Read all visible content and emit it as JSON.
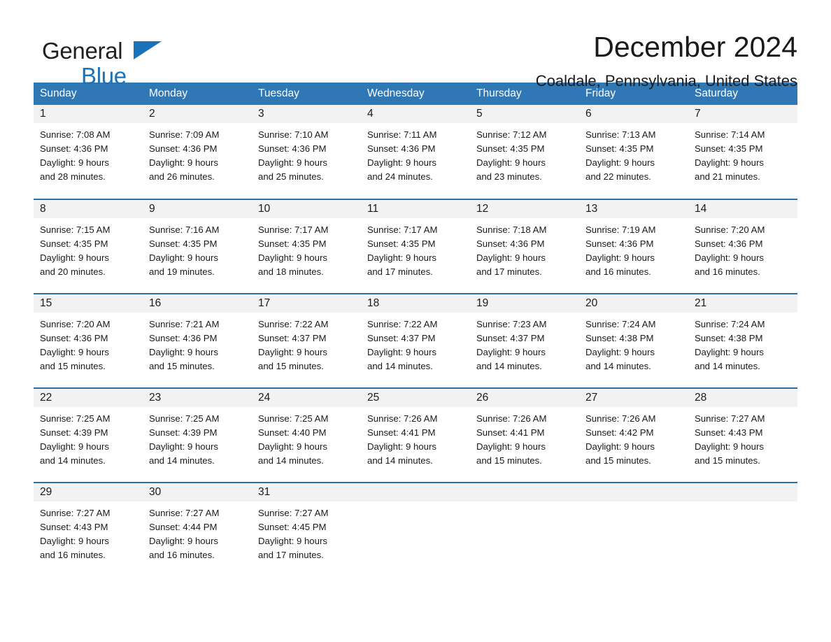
{
  "logo": {
    "word_general": "General",
    "word_blue": "Blue",
    "triangle_color": "#1b72b8"
  },
  "header": {
    "month_title": "December 2024",
    "location": "Coaldale, Pennsylvania, United States"
  },
  "theme": {
    "header_blue": "#3077b5",
    "row_divider_blue": "#2e6da4",
    "daynum_band": "#f2f2f2",
    "text": "#1a1a1a"
  },
  "calendar": {
    "weekday_headers": [
      "Sunday",
      "Monday",
      "Tuesday",
      "Wednesday",
      "Thursday",
      "Friday",
      "Saturday"
    ],
    "weeks": [
      [
        {
          "day": "1",
          "sunrise": "Sunrise: 7:08 AM",
          "sunset": "Sunset: 4:36 PM",
          "daylight_1": "Daylight: 9 hours",
          "daylight_2": "and 28 minutes."
        },
        {
          "day": "2",
          "sunrise": "Sunrise: 7:09 AM",
          "sunset": "Sunset: 4:36 PM",
          "daylight_1": "Daylight: 9 hours",
          "daylight_2": "and 26 minutes."
        },
        {
          "day": "3",
          "sunrise": "Sunrise: 7:10 AM",
          "sunset": "Sunset: 4:36 PM",
          "daylight_1": "Daylight: 9 hours",
          "daylight_2": "and 25 minutes."
        },
        {
          "day": "4",
          "sunrise": "Sunrise: 7:11 AM",
          "sunset": "Sunset: 4:36 PM",
          "daylight_1": "Daylight: 9 hours",
          "daylight_2": "and 24 minutes."
        },
        {
          "day": "5",
          "sunrise": "Sunrise: 7:12 AM",
          "sunset": "Sunset: 4:35 PM",
          "daylight_1": "Daylight: 9 hours",
          "daylight_2": "and 23 minutes."
        },
        {
          "day": "6",
          "sunrise": "Sunrise: 7:13 AM",
          "sunset": "Sunset: 4:35 PM",
          "daylight_1": "Daylight: 9 hours",
          "daylight_2": "and 22 minutes."
        },
        {
          "day": "7",
          "sunrise": "Sunrise: 7:14 AM",
          "sunset": "Sunset: 4:35 PM",
          "daylight_1": "Daylight: 9 hours",
          "daylight_2": "and 21 minutes."
        }
      ],
      [
        {
          "day": "8",
          "sunrise": "Sunrise: 7:15 AM",
          "sunset": "Sunset: 4:35 PM",
          "daylight_1": "Daylight: 9 hours",
          "daylight_2": "and 20 minutes."
        },
        {
          "day": "9",
          "sunrise": "Sunrise: 7:16 AM",
          "sunset": "Sunset: 4:35 PM",
          "daylight_1": "Daylight: 9 hours",
          "daylight_2": "and 19 minutes."
        },
        {
          "day": "10",
          "sunrise": "Sunrise: 7:17 AM",
          "sunset": "Sunset: 4:35 PM",
          "daylight_1": "Daylight: 9 hours",
          "daylight_2": "and 18 minutes."
        },
        {
          "day": "11",
          "sunrise": "Sunrise: 7:17 AM",
          "sunset": "Sunset: 4:35 PM",
          "daylight_1": "Daylight: 9 hours",
          "daylight_2": "and 17 minutes."
        },
        {
          "day": "12",
          "sunrise": "Sunrise: 7:18 AM",
          "sunset": "Sunset: 4:36 PM",
          "daylight_1": "Daylight: 9 hours",
          "daylight_2": "and 17 minutes."
        },
        {
          "day": "13",
          "sunrise": "Sunrise: 7:19 AM",
          "sunset": "Sunset: 4:36 PM",
          "daylight_1": "Daylight: 9 hours",
          "daylight_2": "and 16 minutes."
        },
        {
          "day": "14",
          "sunrise": "Sunrise: 7:20 AM",
          "sunset": "Sunset: 4:36 PM",
          "daylight_1": "Daylight: 9 hours",
          "daylight_2": "and 16 minutes."
        }
      ],
      [
        {
          "day": "15",
          "sunrise": "Sunrise: 7:20 AM",
          "sunset": "Sunset: 4:36 PM",
          "daylight_1": "Daylight: 9 hours",
          "daylight_2": "and 15 minutes."
        },
        {
          "day": "16",
          "sunrise": "Sunrise: 7:21 AM",
          "sunset": "Sunset: 4:36 PM",
          "daylight_1": "Daylight: 9 hours",
          "daylight_2": "and 15 minutes."
        },
        {
          "day": "17",
          "sunrise": "Sunrise: 7:22 AM",
          "sunset": "Sunset: 4:37 PM",
          "daylight_1": "Daylight: 9 hours",
          "daylight_2": "and 15 minutes."
        },
        {
          "day": "18",
          "sunrise": "Sunrise: 7:22 AM",
          "sunset": "Sunset: 4:37 PM",
          "daylight_1": "Daylight: 9 hours",
          "daylight_2": "and 14 minutes."
        },
        {
          "day": "19",
          "sunrise": "Sunrise: 7:23 AM",
          "sunset": "Sunset: 4:37 PM",
          "daylight_1": "Daylight: 9 hours",
          "daylight_2": "and 14 minutes."
        },
        {
          "day": "20",
          "sunrise": "Sunrise: 7:24 AM",
          "sunset": "Sunset: 4:38 PM",
          "daylight_1": "Daylight: 9 hours",
          "daylight_2": "and 14 minutes."
        },
        {
          "day": "21",
          "sunrise": "Sunrise: 7:24 AM",
          "sunset": "Sunset: 4:38 PM",
          "daylight_1": "Daylight: 9 hours",
          "daylight_2": "and 14 minutes."
        }
      ],
      [
        {
          "day": "22",
          "sunrise": "Sunrise: 7:25 AM",
          "sunset": "Sunset: 4:39 PM",
          "daylight_1": "Daylight: 9 hours",
          "daylight_2": "and 14 minutes."
        },
        {
          "day": "23",
          "sunrise": "Sunrise: 7:25 AM",
          "sunset": "Sunset: 4:39 PM",
          "daylight_1": "Daylight: 9 hours",
          "daylight_2": "and 14 minutes."
        },
        {
          "day": "24",
          "sunrise": "Sunrise: 7:25 AM",
          "sunset": "Sunset: 4:40 PM",
          "daylight_1": "Daylight: 9 hours",
          "daylight_2": "and 14 minutes."
        },
        {
          "day": "25",
          "sunrise": "Sunrise: 7:26 AM",
          "sunset": "Sunset: 4:41 PM",
          "daylight_1": "Daylight: 9 hours",
          "daylight_2": "and 14 minutes."
        },
        {
          "day": "26",
          "sunrise": "Sunrise: 7:26 AM",
          "sunset": "Sunset: 4:41 PM",
          "daylight_1": "Daylight: 9 hours",
          "daylight_2": "and 15 minutes."
        },
        {
          "day": "27",
          "sunrise": "Sunrise: 7:26 AM",
          "sunset": "Sunset: 4:42 PM",
          "daylight_1": "Daylight: 9 hours",
          "daylight_2": "and 15 minutes."
        },
        {
          "day": "28",
          "sunrise": "Sunrise: 7:27 AM",
          "sunset": "Sunset: 4:43 PM",
          "daylight_1": "Daylight: 9 hours",
          "daylight_2": "and 15 minutes."
        }
      ],
      [
        {
          "day": "29",
          "sunrise": "Sunrise: 7:27 AM",
          "sunset": "Sunset: 4:43 PM",
          "daylight_1": "Daylight: 9 hours",
          "daylight_2": "and 16 minutes."
        },
        {
          "day": "30",
          "sunrise": "Sunrise: 7:27 AM",
          "sunset": "Sunset: 4:44 PM",
          "daylight_1": "Daylight: 9 hours",
          "daylight_2": "and 16 minutes."
        },
        {
          "day": "31",
          "sunrise": "Sunrise: 7:27 AM",
          "sunset": "Sunset: 4:45 PM",
          "daylight_1": "Daylight: 9 hours",
          "daylight_2": "and 17 minutes."
        },
        {
          "day": "",
          "sunrise": "",
          "sunset": "",
          "daylight_1": "",
          "daylight_2": ""
        },
        {
          "day": "",
          "sunrise": "",
          "sunset": "",
          "daylight_1": "",
          "daylight_2": ""
        },
        {
          "day": "",
          "sunrise": "",
          "sunset": "",
          "daylight_1": "",
          "daylight_2": ""
        },
        {
          "day": "",
          "sunrise": "",
          "sunset": "",
          "daylight_1": "",
          "daylight_2": ""
        }
      ]
    ]
  }
}
